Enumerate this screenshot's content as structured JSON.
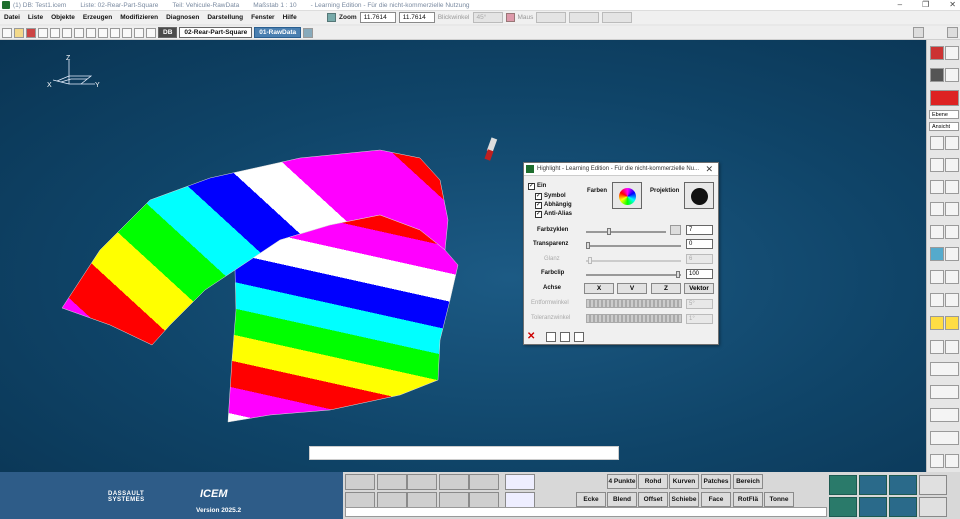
{
  "titlebar": {
    "app": "(1) DB: Test1.icem",
    "list": "Liste: 02-Rear-Part-Square",
    "part": "Teil: Vehicule-RawData",
    "scale": "Maßstab 1 : 10",
    "edition": "- Learning Edition - Für die nicht-kommerzielle Nutzung"
  },
  "menu": [
    "Datei",
    "Liste",
    "Objekte",
    "Erzeugen",
    "Modifizieren",
    "Diagnosen",
    "Darstellung",
    "Fenster",
    "Hilfe"
  ],
  "zoom": {
    "label": "Zoom",
    "value1": "11.7614",
    "value2": "11.7614",
    "angle_label": "Blickwinkel",
    "angle_value": "45°",
    "mouse_label": "Maus"
  },
  "toolbar": {
    "db_tag": "DB",
    "list_tag": "02-Rear-Part-Square",
    "active_tag": "01-RawData"
  },
  "right_palette": {
    "select1": "Ebene",
    "select2": "Ansicht"
  },
  "logo": {
    "company_line1": "DASSAULT",
    "company_line2": "SYSTEMES",
    "product": "ICEM",
    "version": "Version 2025.2"
  },
  "bottom_buttons_row1": [
    "4 Punkte",
    "Rohd",
    "Kurven",
    "Patches",
    "Bereich"
  ],
  "bottom_buttons_row2": [
    "Ecke",
    "Blend",
    "Offset",
    "Schiebe",
    "Face",
    "RotFlä",
    "Tonne"
  ],
  "dialog": {
    "title": "Highlight - Learning Edition - Für die nicht-kommerzielle Nu...",
    "ein": "Ein",
    "symbol": "Symbol",
    "abhaengig": "Abhängig",
    "antialias": "Anti-Alias",
    "farben": "Farben",
    "projektion": "Projektion",
    "farbzyklen": "Farbzyklen",
    "farbzyklen_value": "7",
    "transparenz": "Transparenz",
    "transparenz_value": "0",
    "glanz": "Glanz",
    "glanz_value": "6",
    "farbclip": "Farbclip",
    "farbclip_value": "100",
    "achse": "Achse",
    "axis_x": "X",
    "axis_y": "V",
    "axis_z": "Z",
    "axis_vektor": "Vektor",
    "entformwinkel": "Entformwinkel",
    "entformwinkel_value": "5°",
    "toleranzwinkel": "Toleranzwinkel",
    "toleranzwinkel_value": "1°"
  },
  "axis_labels": {
    "z": "Z",
    "x": "X",
    "y": "Y"
  }
}
